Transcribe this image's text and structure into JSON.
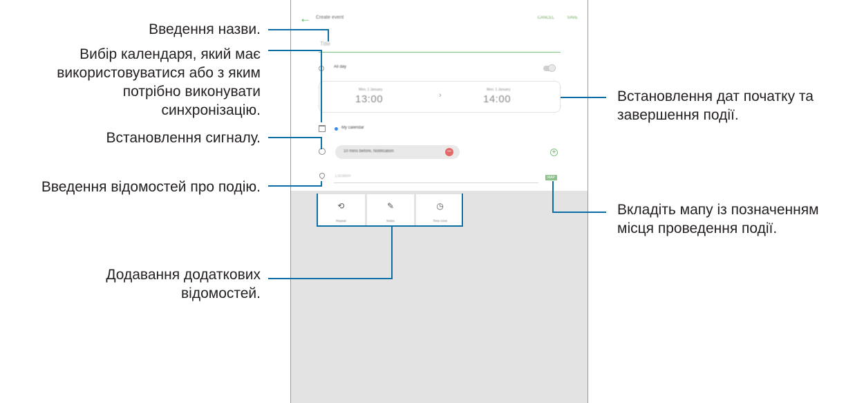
{
  "callouts": {
    "title_entry": "Введення назви.",
    "calendar_choice": [
      "Вибір календаря, який має",
      "використовуватися або з яким",
      "потрібно виконувати",
      "синхронізацію."
    ],
    "alarm_setting": "Встановлення сигналу.",
    "event_details": "Введення відомостей про подію.",
    "additional_details": [
      "Додавання додаткових",
      "відомостей."
    ],
    "dates_setting": [
      "Встановлення дат початку та",
      "завершення події."
    ],
    "attach_map": [
      "Вкладіть мапу із позначенням",
      "місця проведення події."
    ]
  },
  "colors": {
    "callout_line": "#0a6ea5",
    "accent_green": "#6aa84f",
    "panel_gray": "#e3e3e3"
  },
  "screen": {
    "header": {
      "title": "Create event",
      "cancel": "CANCEL",
      "save": "SAVE",
      "back_icon": "arrow-left-icon"
    },
    "title_placeholder": "Title",
    "all_day_label": "All day",
    "date_start_label": "Mon, 1 January",
    "date_start_time": "13:00",
    "date_arrow": "›",
    "date_end_label": "Mon, 1 January",
    "date_end_time": "14:00",
    "calendar_name": "My calendar",
    "alarm_text": "10 mins before, Notification",
    "alarm_remove": "−",
    "alarm_add": "+",
    "location_placeholder": "Location",
    "map_button": "MAP",
    "extra_buttons": [
      {
        "icon": "repeat-icon",
        "glyph": "⟲",
        "label": "Repeat"
      },
      {
        "icon": "notes-icon",
        "glyph": "✎",
        "label": "Notes"
      },
      {
        "icon": "timezone-icon",
        "glyph": "◷",
        "label": "Time zone"
      }
    ]
  }
}
